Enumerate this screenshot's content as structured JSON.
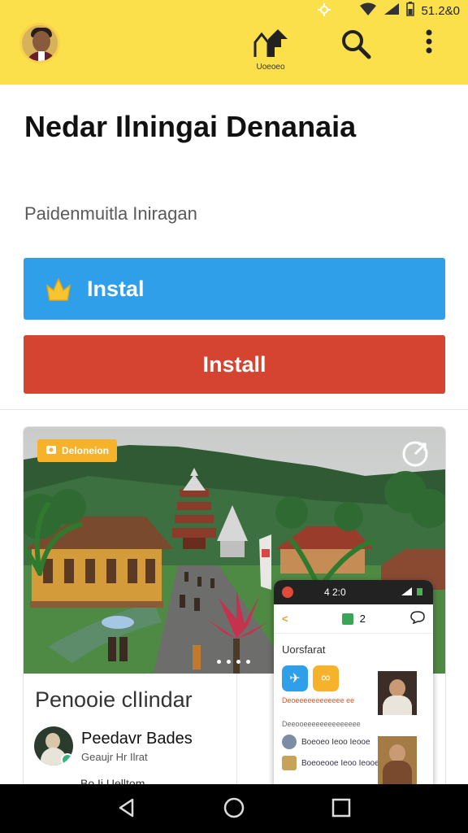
{
  "status_bar": {
    "time": "51.2&0",
    "icons": [
      "settings-icon",
      "wifi-icon",
      "signal-icon",
      "battery-icon"
    ]
  },
  "app_bar": {
    "share_label": "Uoeoeo",
    "actions": [
      "share-icon",
      "search-icon",
      "more-vert-icon"
    ]
  },
  "header": {
    "title": "Nedar Ilningai Denanaia",
    "subtitle": "Paidenmuitla Iniragan"
  },
  "buttons": {
    "primary_label": "Instal",
    "primary_icon": "star-icon",
    "secondary_label": "Install"
  },
  "feature_card": {
    "badge": "Deloneion",
    "caption_title": "Penooie clIindar",
    "author_name": "Peedavr Bades",
    "author_sub": "Geaujr Hr Ilrat",
    "author_more": "Bo Ii Uelltom",
    "carousel_dots": 4
  },
  "phone_mockup": {
    "status_time": "4 2:0",
    "bar_count": "2",
    "heading": "Uorsfarat",
    "app_label": "Deoeeeeeeeeeeee ee",
    "list_header": "Deeooeeeeeeeeeeeeee",
    "rows": [
      "Boeoeo Ieoo Ieooe",
      "Boeoeooe Ieoo Ieooe"
    ]
  },
  "colors": {
    "app_bar": "#fbe04b",
    "primary_button": "#2f9fe9",
    "secondary_button": "#d54431",
    "badge": "#f7b22c"
  },
  "nav_bar": [
    "back-icon",
    "home-icon",
    "recents-icon"
  ]
}
